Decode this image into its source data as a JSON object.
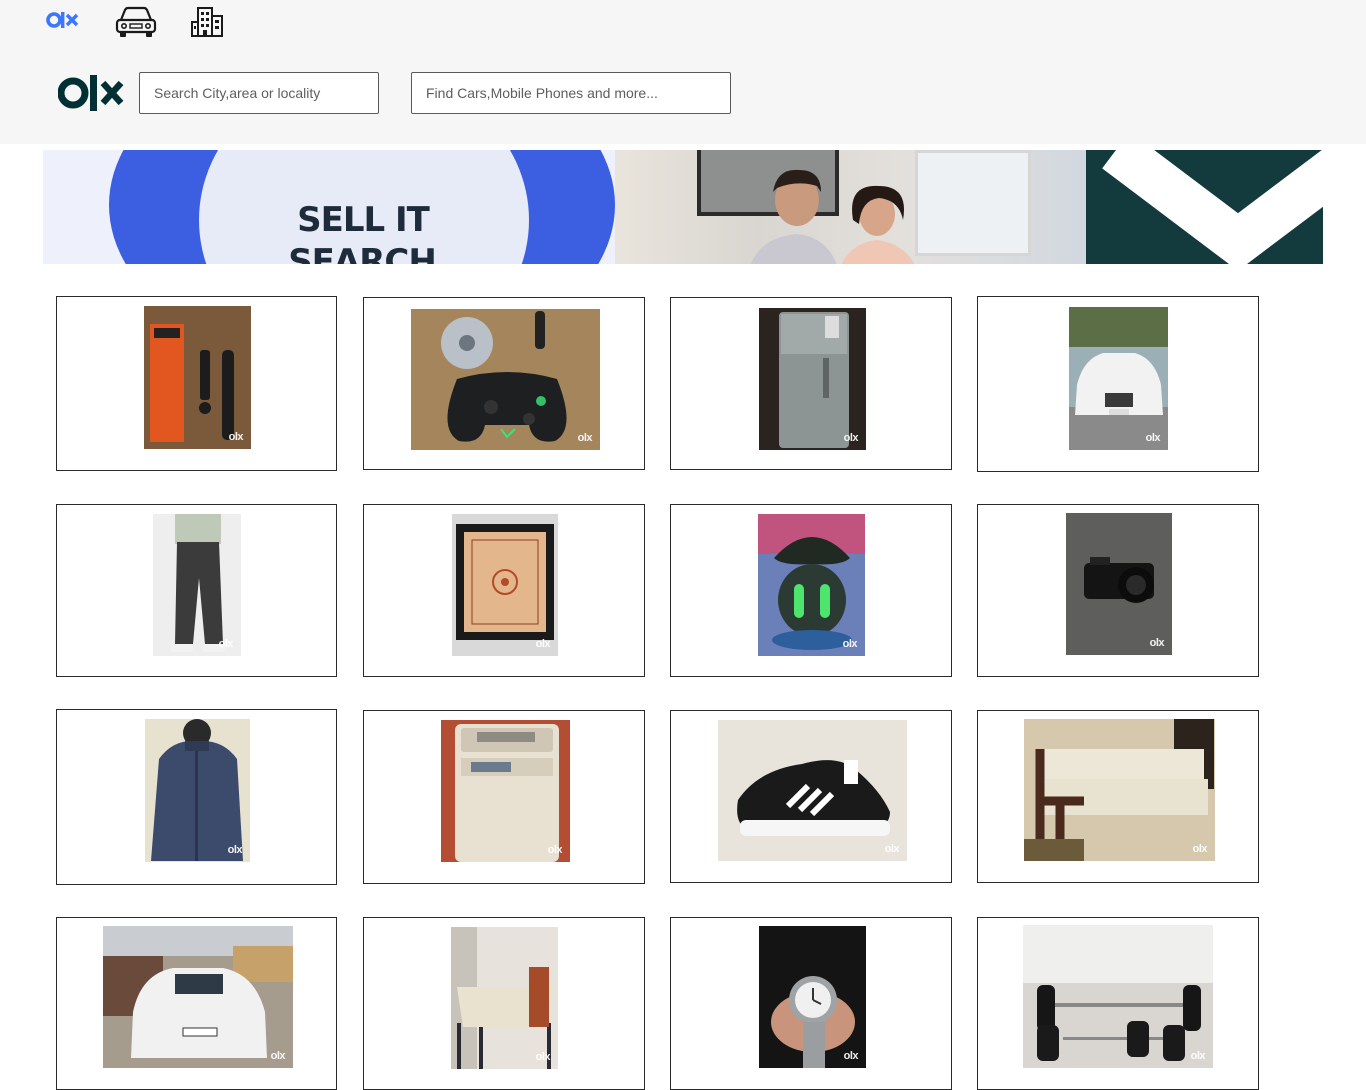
{
  "header": {
    "mini_logo_alt": "olx-logo",
    "main_logo_alt": "olx-logo",
    "brand_color": "#3a77ff",
    "location_search": {
      "placeholder": "Search City,area or locality",
      "value": ""
    },
    "query_search": {
      "placeholder": "Find Cars,Mobile Phones and more...",
      "value": ""
    },
    "category_icons": [
      "car-icon",
      "building-icon"
    ]
  },
  "banner": {
    "headline_line1": "SELL IT",
    "headline_line2": "SEARCH IT",
    "accent_color": "#3b5fe0",
    "dark_color": "#133a3c"
  },
  "listings": [
    {
      "name": "fire-tv-stick",
      "watermark": "olx"
    },
    {
      "name": "game-controller",
      "watermark": "olx"
    },
    {
      "name": "refrigerator",
      "watermark": "olx"
    },
    {
      "name": "white-suv-car",
      "watermark": "olx"
    },
    {
      "name": "jeans",
      "watermark": "olx"
    },
    {
      "name": "carrom-board",
      "watermark": "olx"
    },
    {
      "name": "gaming-earbuds",
      "watermark": "olx"
    },
    {
      "name": "camera",
      "watermark": "olx"
    },
    {
      "name": "leather-jacket",
      "watermark": "olx"
    },
    {
      "name": "washing-machine",
      "watermark": "olx"
    },
    {
      "name": "sneaker-shoe",
      "watermark": "olx"
    },
    {
      "name": "sofa",
      "watermark": "olx"
    },
    {
      "name": "white-ecosport-car",
      "watermark": "olx"
    },
    {
      "name": "dining-table",
      "watermark": "olx"
    },
    {
      "name": "wrist-watch",
      "watermark": "olx"
    },
    {
      "name": "dumbbells",
      "watermark": "olx"
    }
  ]
}
